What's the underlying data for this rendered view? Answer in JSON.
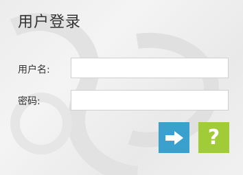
{
  "login_panel": {
    "title": "用户登录",
    "username_label": "用户名:",
    "username_value": "",
    "password_label": "密码:",
    "password_value": ""
  },
  "actions": {
    "help_glyph": "?"
  },
  "colors": {
    "login_button": "#3aa1cf",
    "help_button": "#a2cb38"
  },
  "icons": {
    "login": "arrow-right-icon",
    "help": "question-mark-icon"
  }
}
